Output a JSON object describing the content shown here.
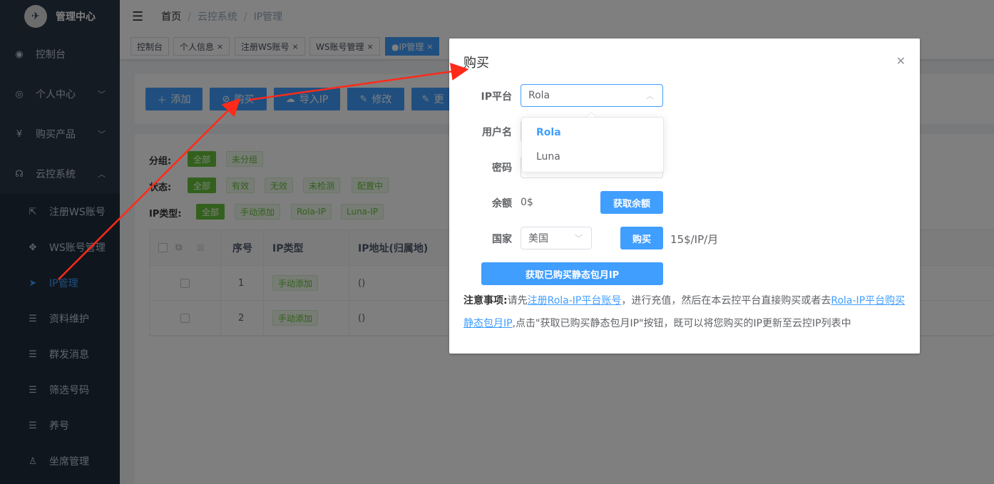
{
  "sidebar": {
    "logo_icon": "bird-logo",
    "title": "管理中心",
    "items": [
      {
        "label": "控制台",
        "icon": "dashboard-icon"
      },
      {
        "label": "个人中心",
        "icon": "user-circle-icon"
      },
      {
        "label": "购买产品",
        "icon": "yen-icon"
      },
      {
        "label": "云控系统",
        "icon": "headset-icon"
      }
    ],
    "sub_items": [
      {
        "label": "注册WS账号",
        "icon": "external-link-icon"
      },
      {
        "label": "WS账号管理",
        "icon": "move-icon"
      },
      {
        "label": "IP管理",
        "icon": "send-icon",
        "active": true
      },
      {
        "label": "资料维护",
        "icon": "sliders-icon"
      },
      {
        "label": "群发消息",
        "icon": "sliders-icon"
      },
      {
        "label": "筛选号码",
        "icon": "sliders-icon"
      },
      {
        "label": "养号",
        "icon": "sliders-icon"
      },
      {
        "label": "坐席管理",
        "icon": "user-icon"
      }
    ]
  },
  "breadcrumb": {
    "home": "首页",
    "parent": "云控系统",
    "current": "IP管理"
  },
  "tags": [
    {
      "label": "控制台"
    },
    {
      "label": "个人信息"
    },
    {
      "label": "注册WS账号"
    },
    {
      "label": "WS账号管理"
    },
    {
      "label": "●IP管理",
      "active": true
    }
  ],
  "toolbar": {
    "add": "添加",
    "buy": "购买",
    "import": "导入IP",
    "edit": "修改",
    "more": "更"
  },
  "filters": {
    "group_label": "分组:",
    "group_options": [
      "全部",
      "未分组"
    ],
    "status_label": "状态:",
    "status_options": [
      "全部",
      "有效",
      "无效",
      "未检测",
      "配置中"
    ],
    "type_label": "IP类型:",
    "type_options": [
      "全部",
      "手动添加",
      "Rola-IP",
      "Luna-IP"
    ]
  },
  "table": {
    "columns": [
      "序号",
      "IP类型",
      "IP地址(归属地)"
    ],
    "rows": [
      {
        "index": "1",
        "type": "手动添加",
        "address": "()"
      },
      {
        "index": "2",
        "type": "手动添加",
        "address": "()"
      }
    ]
  },
  "dialog": {
    "title": "购买",
    "platform_label": "IP平台",
    "platform_value": "Rola",
    "platform_options": [
      "Rola",
      "Luna"
    ],
    "username_label": "用户名",
    "password_label": "密码",
    "balance_label": "余额",
    "balance_value": "0$",
    "get_balance_button": "获取余额",
    "country_label": "国家",
    "country_value": "美国",
    "buy_button": "购买",
    "price": "15$/IP/月",
    "fetch_button": "获取已购买静态包月IP",
    "note_prefix": "注意事项:",
    "note_text1": "请先",
    "note_link1": "注册Rola-IP平台账号",
    "note_text2": "，进行充值，然后在本云控平台直接购买或者去",
    "note_link2": "Rola-IP平台购买静态包月IP",
    "note_text3": ",点击\"获取已购买静态包月IP\"按钮，既可以将您购买的IP更新至云控IP列表中"
  },
  "colors": {
    "primary": "#409eff",
    "sidebar": "#2b3646",
    "success": "#67c23a",
    "annotation": "#ff2a1a"
  }
}
